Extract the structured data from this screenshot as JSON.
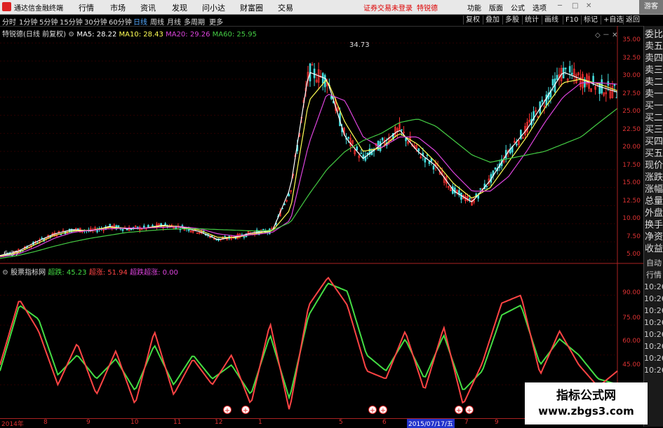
{
  "titlebar": {
    "app_name": "通达信金融终端",
    "menus": [
      "行情",
      "市场",
      "资讯",
      "发现",
      "问小达",
      "财富圈",
      "交易"
    ],
    "notice": "证券交易未登录",
    "stock": "特锐德",
    "right_menus": [
      "功能",
      "版面",
      "公式",
      "选项"
    ],
    "guest": "游客"
  },
  "toolbar": {
    "periods": [
      "分时",
      "1分钟",
      "5分钟",
      "15分钟",
      "30分钟",
      "60分钟",
      "日线",
      "周线",
      "月线",
      "多周期",
      "更多"
    ],
    "active_period": "日线",
    "right_buttons": [
      "复权",
      "叠加",
      "多股",
      "统计",
      "画线",
      "F10",
      "标记",
      "+自选",
      "返回"
    ]
  },
  "main_legend": {
    "title": "特锐德(日线 前复权)",
    "ma": [
      {
        "label": "MA5: 28.22",
        "color": "#ffffff"
      },
      {
        "label": "MA10: 28.43",
        "color": "#ffff55"
      },
      {
        "label": "MA20: 29.26",
        "color": "#dd44dd"
      },
      {
        "label": "MA60: 25.95",
        "color": "#44cc44"
      }
    ],
    "high_label": "34.73",
    "low_label": "6.37"
  },
  "sub_legend": {
    "title": "股票指标网",
    "items": [
      {
        "label": "超跌: 45.23",
        "color": "#44dd44"
      },
      {
        "label": "超涨: 51.94",
        "color": "#ff4444"
      },
      {
        "label": "超跌超涨: 0.00",
        "color": "#dd44dd"
      }
    ]
  },
  "right_panel": {
    "labels": [
      "委比",
      "卖五",
      "卖四",
      "卖三",
      "卖二",
      "卖一",
      "买一",
      "买二",
      "买三",
      "买四",
      "买五",
      "现价",
      "涨跌",
      "涨幅",
      "总量",
      "外盘",
      "换手",
      "净资",
      "收益",
      "自动",
      "行情",
      "10:26",
      "10:26",
      "10:26",
      "10:26",
      "10:26",
      "10:26",
      "10:26",
      "10:26"
    ]
  },
  "price_axis": [
    "35.00",
    "32.50",
    "30.00",
    "27.50",
    "25.00",
    "22.50",
    "20.00",
    "17.50",
    "15.00",
    "12.50",
    "10.00",
    "7.50",
    "5.00"
  ],
  "osc_axis": [
    "90.00",
    "75.00",
    "60.00",
    "45.00"
  ],
  "date_axis": {
    "labels": [
      "2014年",
      "8",
      "9",
      "10",
      "11",
      "12",
      "1",
      "5",
      "6",
      "7",
      "9",
      "10"
    ],
    "cursor_date": "2015/07/17/五"
  },
  "watermark": {
    "line1": "指标公式网",
    "line2": "www.zbgs3.com"
  },
  "chart_data": [
    {
      "type": "line",
      "title": "特锐德(日线 前复权)",
      "ylim": [
        5.0,
        36.0
      ],
      "series": [
        {
          "name": "MA5",
          "color": "#ffffff",
          "values": [
            5.6,
            6.2,
            7.5,
            8.6,
            9.2,
            9.0,
            9.6,
            9.3,
            9.4,
            9.8,
            9.5,
            8.9,
            7.8,
            8.2,
            8.8,
            9.0,
            15,
            31,
            30,
            22,
            19,
            21,
            23,
            20,
            18,
            14.5,
            13,
            16,
            20,
            23,
            27,
            31,
            30,
            29,
            28.2
          ]
        },
        {
          "name": "MA10",
          "color": "#ffff55",
          "values": [
            5.5,
            6.0,
            7.2,
            8.4,
            9.0,
            9.1,
            9.5,
            9.4,
            9.4,
            9.7,
            9.6,
            9.1,
            8.1,
            8.1,
            8.6,
            9.0,
            12,
            27,
            30,
            24,
            20,
            20.5,
            22.5,
            21,
            18.5,
            15.5,
            13.5,
            15,
            18.5,
            22,
            26,
            29.5,
            30,
            29.3,
            28.4
          ]
        },
        {
          "name": "MA20",
          "color": "#dd44dd",
          "values": [
            5.4,
            5.8,
            6.8,
            8.0,
            8.8,
            9.1,
            9.3,
            9.4,
            9.4,
            9.5,
            9.6,
            9.3,
            8.6,
            8.3,
            8.5,
            8.8,
            10.5,
            21,
            28,
            27,
            22,
            20.5,
            22,
            22,
            20,
            17,
            14.5,
            14.5,
            16.5,
            20,
            24,
            27.5,
            29.5,
            29.5,
            29.3
          ]
        },
        {
          "name": "MA60",
          "color": "#44cc44",
          "values": [
            5.2,
            5.6,
            6.2,
            6.9,
            7.5,
            8.0,
            8.4,
            8.8,
            9.0,
            9.2,
            9.3,
            9.3,
            9.2,
            9.1,
            9.0,
            9.1,
            10.2,
            14,
            17.5,
            20,
            21.5,
            22.5,
            24,
            24.5,
            23.5,
            21.5,
            19.5,
            18.5,
            19,
            19.5,
            20,
            21,
            22,
            24,
            25.95
          ]
        }
      ]
    },
    {
      "type": "line",
      "title": "股票指标网",
      "ylim": [
        30,
        100
      ],
      "series": [
        {
          "name": "超跌",
          "color": "#44dd44",
          "values": [
            52,
            85,
            78,
            50,
            60,
            48,
            58,
            42,
            65,
            45,
            60,
            48,
            55,
            40,
            70,
            38,
            80,
            96,
            92,
            60,
            52,
            68,
            48,
            70,
            42,
            52,
            80,
            85,
            55,
            68,
            60,
            48,
            45.23
          ]
        },
        {
          "name": "超涨",
          "color": "#ff4444",
          "values": [
            55,
            88,
            72,
            45,
            66,
            40,
            62,
            35,
            72,
            40,
            58,
            45,
            60,
            35,
            76,
            32,
            85,
            99,
            85,
            52,
            48,
            72,
            42,
            74,
            35,
            56,
            86,
            90,
            50,
            72,
            55,
            44,
            51.94
          ]
        }
      ]
    }
  ]
}
